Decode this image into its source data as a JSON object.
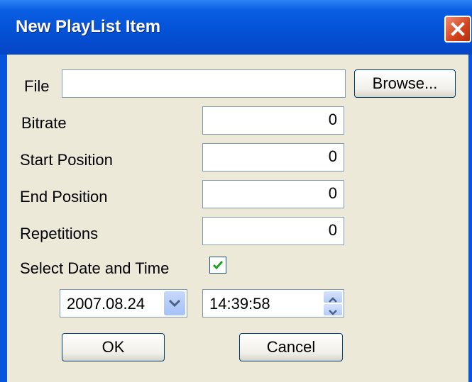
{
  "window": {
    "title": "New PlayList Item"
  },
  "form": {
    "file_label": "File",
    "file_value": "",
    "browse_label": "Browse...",
    "bitrate_label": "Bitrate",
    "bitrate_value": "0",
    "start_label": "Start Position",
    "start_value": "0",
    "end_label": "End Position",
    "end_value": "0",
    "repetitions_label": "Repetitions",
    "repetitions_value": "0",
    "datetime_label": "Select Date and Time",
    "datetime_checked": true,
    "date_value": "2007.08.24",
    "time_value": "14:39:58"
  },
  "buttons": {
    "ok": "OK",
    "cancel": "Cancel"
  },
  "icons": {
    "close": "close-icon",
    "check": "checkmark-icon",
    "dropdown": "chevron-down-icon",
    "spin": "spin-arrows-icon"
  },
  "colors": {
    "titlebar": "#0350d5",
    "client": "#ece9d8",
    "close": "#d2421c",
    "check": "#21a121"
  }
}
